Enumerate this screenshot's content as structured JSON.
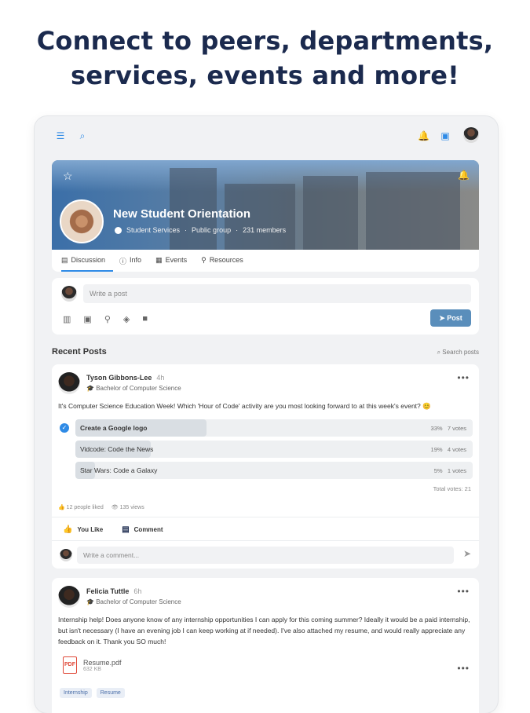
{
  "headline": {
    "line1": "Connect to peers, departments,",
    "line2": "services, events and more!"
  },
  "topbar": {
    "menu_icon": "menu-icon",
    "search_icon": "search-icon",
    "notifications_icon": "bell-icon",
    "messages_icon": "chat-icon"
  },
  "group": {
    "title": "New Student Orientation",
    "owner": "Student Services",
    "privacy": "Public group",
    "members": "231 members"
  },
  "tabs": [
    {
      "label": "Discussion",
      "icon": "discussion-icon",
      "active": true
    },
    {
      "label": "Info",
      "icon": "info-icon"
    },
    {
      "label": "Events",
      "icon": "calendar-icon"
    },
    {
      "label": "Resources",
      "icon": "paperclip-icon"
    }
  ],
  "composer": {
    "placeholder": "Write a post",
    "post_label": "Post"
  },
  "recent": {
    "title": "Recent Posts",
    "search_label": "Search posts"
  },
  "post1": {
    "author": "Tyson Gibbons-Lee",
    "time": "4h",
    "program": "Bachelor of Computer Science",
    "text": "It's Computer Science Education Week! Which 'Hour of Code' activity are you most looking forward to at this week's event? 😊",
    "poll": [
      {
        "label": "Create a Google logo",
        "percent": "33%",
        "votes": "7 votes",
        "fraction": 0.33,
        "selected": true
      },
      {
        "label": "Vidcode: Code the News",
        "percent": "19%",
        "votes": "4 votes",
        "fraction": 0.19
      },
      {
        "label": "Star Wars: Code a Galaxy",
        "percent": "5%",
        "votes": "1 votes",
        "fraction": 0.05
      }
    ],
    "total_votes": "Total votes: 21",
    "likes": "12 people liked",
    "views": "135 views",
    "like_label": "You Like",
    "comment_label": "Comment",
    "comment_placeholder": "Write a comment..."
  },
  "post2": {
    "author": "Felicia Tuttle",
    "time": "6h",
    "program": "Bachelor of Computer Science",
    "text": "Internship help! Does anyone know of any internship opportunities I can apply for this coming summer? Ideally it would be a paid internship, but isn't necessary (I have an evening job I can keep working at if needed). I've also attached my resume, and would really appreciate any feedback on it. Thank you SO much!",
    "file_name": "Resume.pdf",
    "file_size": "632 KB",
    "tags": [
      "Internship",
      "Resume"
    ]
  }
}
